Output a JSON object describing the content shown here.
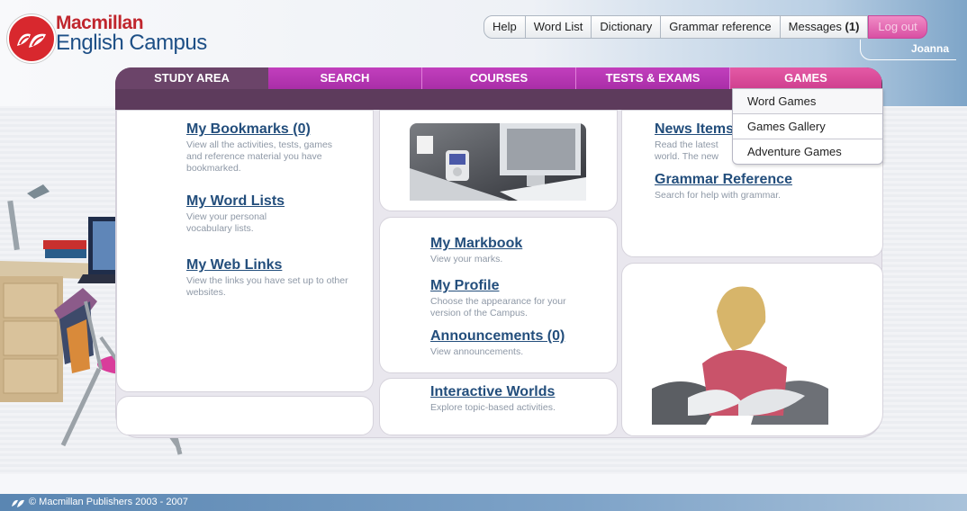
{
  "brand": {
    "line1": "Macmillan",
    "line2": "English Campus"
  },
  "topbar": {
    "help": "Help",
    "word_list": "Word List",
    "dictionary": "Dictionary",
    "grammar_reference": "Grammar reference",
    "messages": "Messages",
    "messages_count": "(1)",
    "logout": "Log out",
    "user": "Joanna"
  },
  "nav": {
    "study_area": "STUDY AREA",
    "search": "SEARCH",
    "courses": "COURSES",
    "tests_exams": "TESTS & EXAMS",
    "games": "GAMES"
  },
  "games_menu": [
    "Word Games",
    "Games Gallery",
    "Adventure Games"
  ],
  "left": {
    "bookmarks": {
      "title": "My Bookmarks (0)",
      "desc": "View all the activities, tests, games and reference material you have bookmarked."
    },
    "word_lists": {
      "title": "My Word Lists",
      "desc": "View your personal vocabulary lists."
    },
    "web_links": {
      "title": "My Web Links",
      "desc": "View the links you have set up to other websites."
    }
  },
  "middle": {
    "markbook": {
      "title": "My Markbook",
      "desc": "View your marks."
    },
    "profile": {
      "title": "My Profile",
      "desc": "Choose the appearance for your version of the Campus."
    },
    "announcements": {
      "title": "Announcements (0)",
      "desc": "View announcements."
    },
    "worlds": {
      "title": "Interactive Worlds",
      "desc": "Explore topic-based activities."
    }
  },
  "right": {
    "news": {
      "title": "News Items",
      "desc_l1": "Read the latest",
      "desc_l2": "world. The new"
    },
    "grammar": {
      "title": "Grammar Reference",
      "desc": "Search for help with grammar."
    }
  },
  "footer": {
    "copyright": "© Macmillan Publishers 2003 - 2007"
  },
  "colors": {
    "nav_purple": "#6b4469",
    "nav_magenta": "#b236b0",
    "games_pink": "#d94a9a",
    "link_blue": "#234e7c",
    "logo_red": "#d8282e"
  }
}
